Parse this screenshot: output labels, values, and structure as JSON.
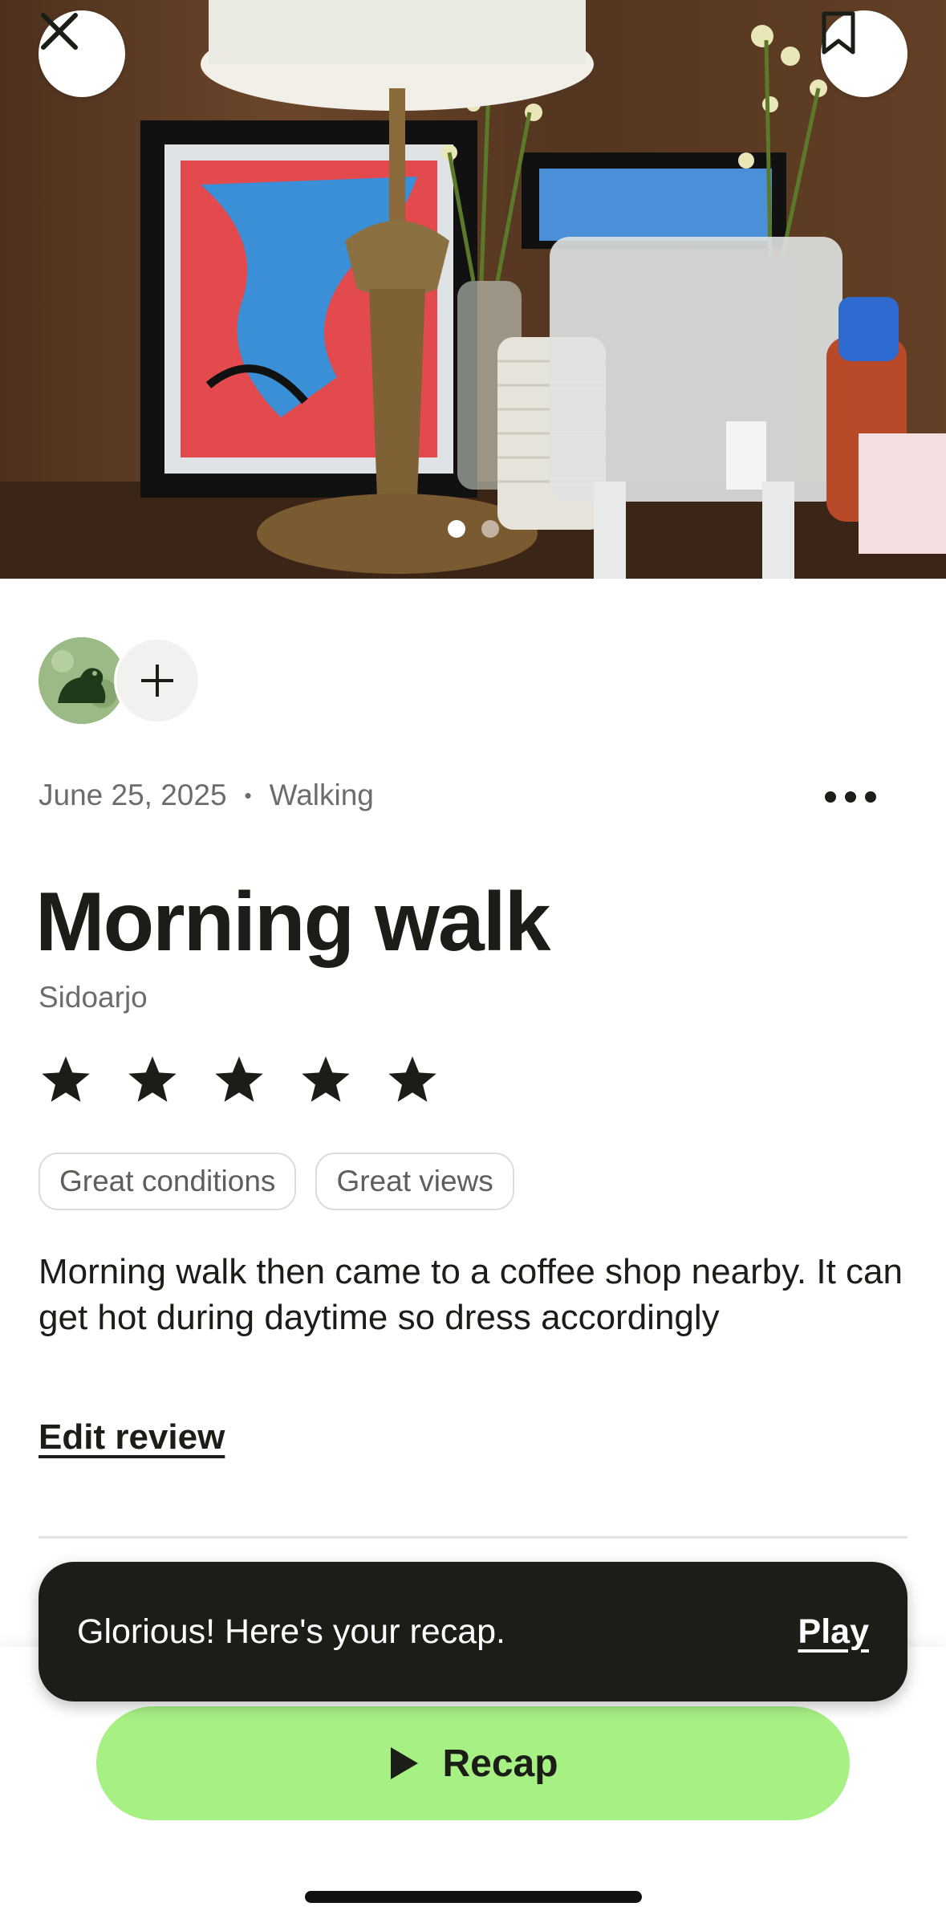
{
  "hero": {
    "photo_alt": "Photo of a cafe counter with a brass lamp, framed art, flowers, cups and a water dispenser",
    "photo_count": 2,
    "active_photo_index": 0,
    "close_icon": "close-icon",
    "bookmark_icon": "bookmark-icon"
  },
  "participants": {
    "avatar_icon": "frog-avatar",
    "add_icon": "plus-icon"
  },
  "activity": {
    "date": "June 25, 2025",
    "separator": "•",
    "type": "Walking",
    "title": "Morning walk",
    "location": "Sidoarjo",
    "rating": 5,
    "rating_max": 5,
    "tags": [
      "Great conditions",
      "Great views"
    ],
    "description": "Morning walk then came to a coffee shop nearby. It can get hot during daytime so dress accordingly",
    "edit_label": "Edit review"
  },
  "toast": {
    "message": "Glorious! Here's your recap.",
    "action": "Play"
  },
  "recap_button": {
    "label": "Recap",
    "icon": "play-icon"
  },
  "colors": {
    "accent_green": "#a7f084",
    "dark": "#1b1d17",
    "muted_text": "#6b6e68"
  }
}
